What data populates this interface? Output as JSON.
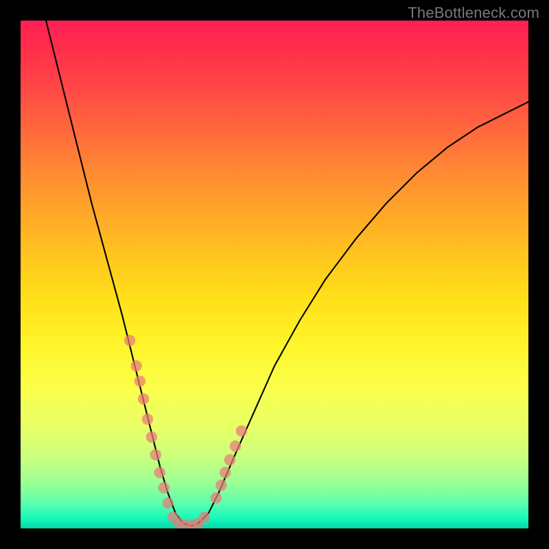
{
  "watermark": "TheBottleneck.com",
  "chart_data": {
    "type": "line",
    "title": "",
    "xlabel": "",
    "ylabel": "",
    "xlim": [
      0,
      100
    ],
    "ylim": [
      0,
      100
    ],
    "curve": {
      "x": [
        5,
        8,
        11,
        14,
        17,
        20,
        22,
        24,
        26,
        27.5,
        29,
        30.5,
        32,
        33.5,
        35,
        37,
        39,
        42,
        46,
        50,
        55,
        60,
        66,
        72,
        78,
        84,
        90,
        96,
        100
      ],
      "y": [
        100,
        88,
        76,
        64,
        53,
        42,
        34,
        26,
        18,
        12,
        7,
        3,
        1,
        0.5,
        1,
        3,
        7,
        14,
        23,
        32,
        41,
        49,
        57,
        64,
        70,
        75,
        79,
        82,
        84
      ]
    },
    "scatter_left": {
      "x": [
        21.5,
        22.8,
        23.5,
        24.2,
        25.0,
        25.8,
        26.6,
        27.4,
        28.2,
        29.0
      ],
      "y": [
        37,
        32,
        29,
        25.5,
        21.5,
        18,
        14.5,
        11,
        8,
        5
      ]
    },
    "scatter_right": {
      "x": [
        38.5,
        39.5,
        40.3,
        41.2,
        42.3,
        43.5
      ],
      "y": [
        6,
        8.5,
        11,
        13.5,
        16.2,
        19.2
      ]
    },
    "scatter_bottom": {
      "x": [
        30.0,
        31.2,
        32.5,
        33.8,
        35.0,
        36.2
      ],
      "y": [
        2.2,
        1.0,
        0.6,
        0.6,
        1.0,
        2.2
      ]
    },
    "dot_radius": 8.2
  }
}
